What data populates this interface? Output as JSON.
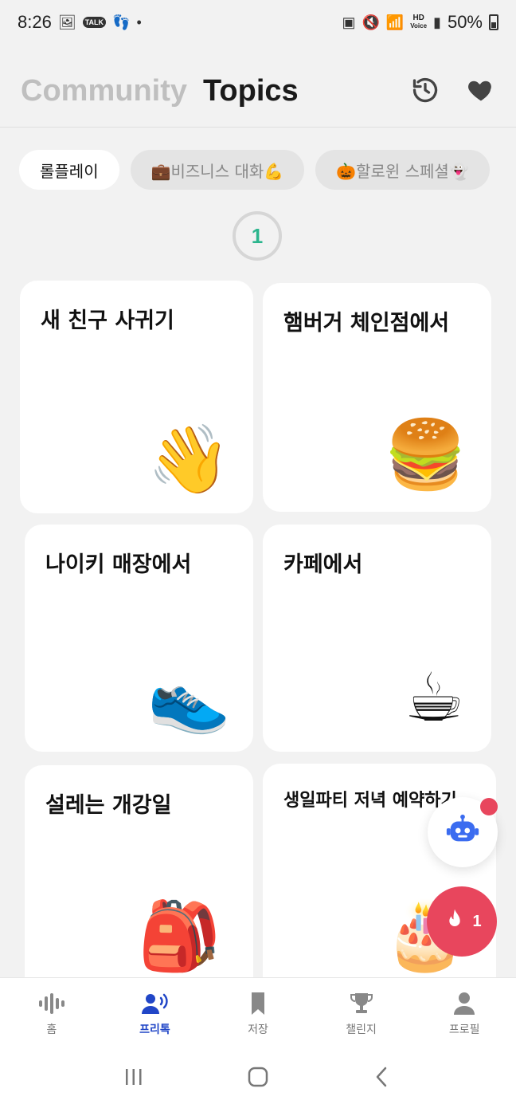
{
  "status_bar": {
    "time": "8:26",
    "battery": "50%",
    "talk_badge": "TALK",
    "hd_line1": "HD",
    "hd_line2": "Voice"
  },
  "header": {
    "tabs": [
      {
        "label": "Community"
      },
      {
        "label": "Topics"
      }
    ]
  },
  "chips": [
    {
      "label": "롤플레이"
    },
    {
      "label": "💼비즈니스 대화💪"
    },
    {
      "label": "🎃할로윈 스페셜👻"
    }
  ],
  "page_indicator": "1",
  "cards": [
    {
      "title": "새 친구 사귀기",
      "emoji": "👋"
    },
    {
      "title": "햄버거 체인점에서",
      "emoji": "🍔"
    },
    {
      "title": "나이키 매장에서",
      "emoji": "👟"
    },
    {
      "title": "카페에서",
      "emoji": "☕"
    },
    {
      "title": "설레는 개강일",
      "emoji": "🎒"
    },
    {
      "title": "생일파티 저녁 예약하기",
      "emoji": "🎂"
    }
  ],
  "fab": {
    "streak_count": "1"
  },
  "bottom_nav": [
    {
      "label": "홈",
      "icon": "voice-wave-icon"
    },
    {
      "label": "프리톡",
      "icon": "people-talk-icon"
    },
    {
      "label": "저장",
      "icon": "bookmark-icon"
    },
    {
      "label": "챌린지",
      "icon": "trophy-icon"
    },
    {
      "label": "프로필",
      "icon": "person-icon"
    }
  ],
  "colors": {
    "accent": "#2146c7",
    "green": "#2bb58d",
    "fire": "#e8465d"
  }
}
